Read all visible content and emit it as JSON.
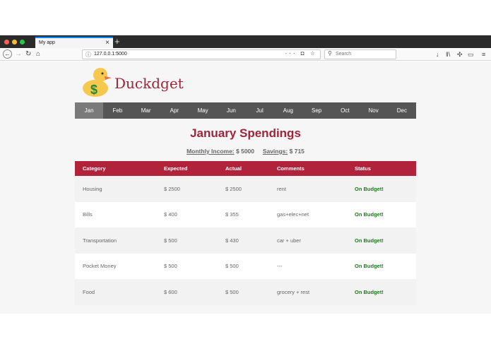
{
  "browser": {
    "tab_title": "My app",
    "tab_close": "×",
    "new_tab": "+",
    "url": "127.0.0.1:5000",
    "url_actions": "··· ◘ ☆",
    "search_placeholder": "Search",
    "nav_icons": {
      "back": "←",
      "forward": "→",
      "reload": "↻",
      "home": "⌂"
    },
    "right_icons": {
      "download": "↓",
      "library": "‖\\",
      "extensions": "✣",
      "sidebar": "▭",
      "menu": "≡"
    }
  },
  "app": {
    "brand": "Duckdget",
    "months": [
      {
        "label": "Jan",
        "active": true
      },
      {
        "label": "Feb"
      },
      {
        "label": "Mar"
      },
      {
        "label": "Apr"
      },
      {
        "label": "May"
      },
      {
        "label": "Jun"
      },
      {
        "label": "Jul"
      },
      {
        "label": "Aug"
      },
      {
        "label": "Sep"
      },
      {
        "label": "Oct"
      },
      {
        "label": "Nov"
      },
      {
        "label": "Dec"
      }
    ],
    "title": "January Spendings",
    "summary": {
      "income_label": "Monthly Income:",
      "income_value": "$ 5000",
      "savings_label": "Savings:",
      "savings_value": "$ 715"
    },
    "table": {
      "headers": [
        "Category",
        "Expected",
        "Actual",
        "Comments",
        "Status"
      ],
      "rows": [
        [
          "Housing",
          "$ 2500",
          "$ 2500",
          "rent",
          "On Budget!"
        ],
        [
          "Bills",
          "$ 400",
          "$ 355",
          "gas+elec+net",
          "On Budget!"
        ],
        [
          "Transportation",
          "$ 500",
          "$ 430",
          "car + uber",
          "On Budget!"
        ],
        [
          "Pocket Money",
          "$ 500",
          "$ 500",
          "---",
          "On Budget!"
        ],
        [
          "Food",
          "$ 600",
          "$ 500",
          "grocery + rest",
          "On Budget!"
        ]
      ]
    }
  },
  "colors": {
    "accent": "#a0243a",
    "header_row": "#b0233a",
    "nav_bg": "#555555",
    "nav_active": "#7a7a7a",
    "status_ok": "#1c7a1c",
    "window_dots": [
      "#ff5f57",
      "#febc2e",
      "#28c840"
    ]
  }
}
